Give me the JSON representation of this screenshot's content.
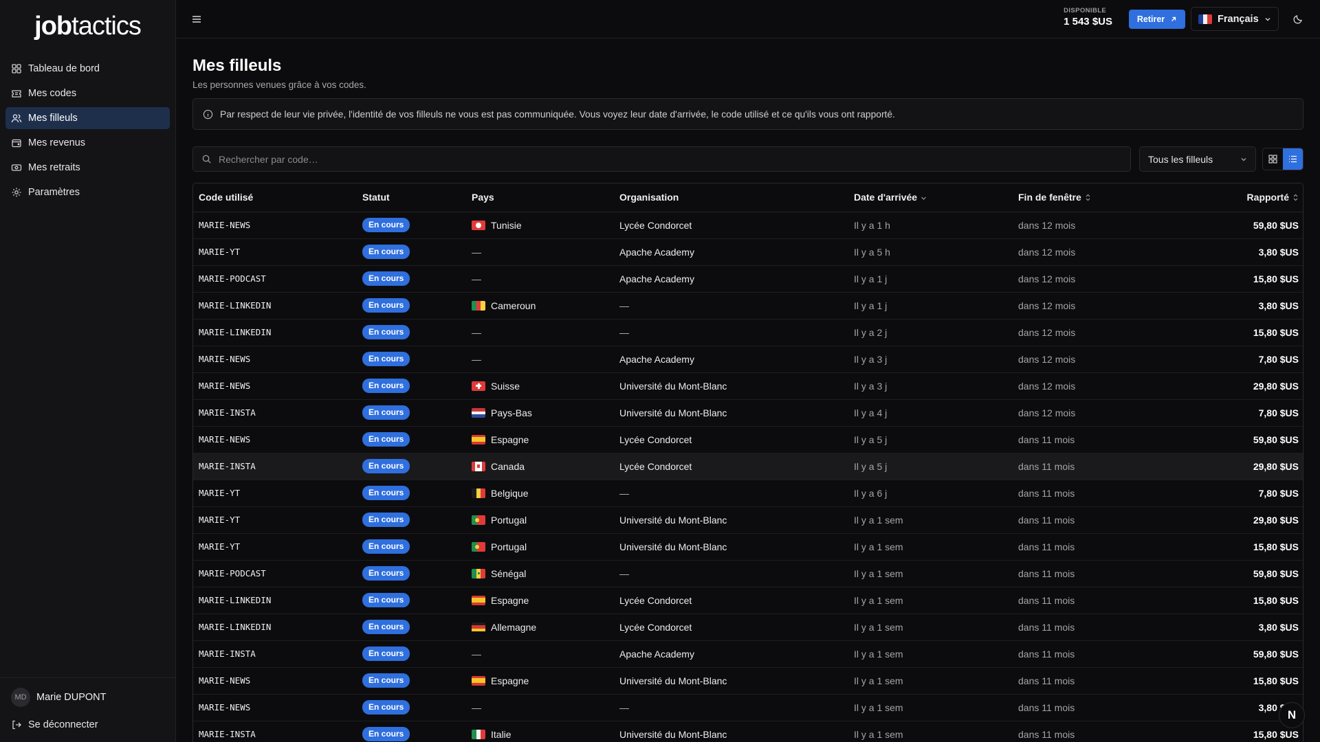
{
  "brand": {
    "logo_bold": "job",
    "logo_rest": "tactics"
  },
  "sidebar": {
    "items": [
      {
        "label": "Tableau de bord",
        "icon": "dashboard-icon"
      },
      {
        "label": "Mes codes",
        "icon": "ticket-icon"
      },
      {
        "label": "Mes filleuls",
        "icon": "users-icon",
        "active": true
      },
      {
        "label": "Mes revenus",
        "icon": "wallet-icon"
      },
      {
        "label": "Mes retraits",
        "icon": "banknote-icon"
      },
      {
        "label": "Paramètres",
        "icon": "gear-icon"
      }
    ],
    "user": {
      "initials": "MD",
      "name": "Marie DUPONT"
    },
    "logout_label": "Se déconnecter"
  },
  "topbar": {
    "balance_label": "DISPONIBLE",
    "balance_value": "1 543 $US",
    "withdraw_label": "Retirer",
    "language": "Français"
  },
  "page": {
    "title": "Mes filleuls",
    "subtitle": "Les personnes venues grâce à vos codes.",
    "notice": "Par respect de leur vie privée, l'identité de vos filleuls ne vous est pas communiquée. Vous voyez leur date d'arrivée, le code utilisé et ce qu'ils vous ont rapporté.",
    "search_placeholder": "Rechercher par code…",
    "filter_value": "Tous les filleuls"
  },
  "table": {
    "headers": {
      "code": "Code utilisé",
      "status": "Statut",
      "country": "Pays",
      "org": "Organisation",
      "arrival": "Date d'arrivée",
      "window_end": "Fin de fenêtre",
      "earned": "Rapporté"
    },
    "rows": [
      {
        "code": "MARIE-NEWS",
        "status": "En cours",
        "country": "Tunisie",
        "flag": "tn",
        "org": "Lycée Condorcet",
        "arrival": "Il y a 1 h",
        "end": "dans 12 mois",
        "amount": "59,80 $US"
      },
      {
        "code": "MARIE-YT",
        "status": "En cours",
        "country": "—",
        "flag": "",
        "org": "Apache Academy",
        "arrival": "Il y a 5 h",
        "end": "dans 12 mois",
        "amount": "3,80 $US"
      },
      {
        "code": "MARIE-PODCAST",
        "status": "En cours",
        "country": "—",
        "flag": "",
        "org": "Apache Academy",
        "arrival": "Il y a 1 j",
        "end": "dans 12 mois",
        "amount": "15,80 $US"
      },
      {
        "code": "MARIE-LINKEDIN",
        "status": "En cours",
        "country": "Cameroun",
        "flag": "cm",
        "org": "—",
        "arrival": "Il y a 1 j",
        "end": "dans 12 mois",
        "amount": "3,80 $US"
      },
      {
        "code": "MARIE-LINKEDIN",
        "status": "En cours",
        "country": "—",
        "flag": "",
        "org": "—",
        "arrival": "Il y a 2 j",
        "end": "dans 12 mois",
        "amount": "15,80 $US"
      },
      {
        "code": "MARIE-NEWS",
        "status": "En cours",
        "country": "—",
        "flag": "",
        "org": "Apache Academy",
        "arrival": "Il y a 3 j",
        "end": "dans 12 mois",
        "amount": "7,80 $US"
      },
      {
        "code": "MARIE-NEWS",
        "status": "En cours",
        "country": "Suisse",
        "flag": "ch",
        "org": "Université du Mont-Blanc",
        "arrival": "Il y a 3 j",
        "end": "dans 12 mois",
        "amount": "29,80 $US"
      },
      {
        "code": "MARIE-INSTA",
        "status": "En cours",
        "country": "Pays-Bas",
        "flag": "nl",
        "org": "Université du Mont-Blanc",
        "arrival": "Il y a 4 j",
        "end": "dans 12 mois",
        "amount": "7,80 $US"
      },
      {
        "code": "MARIE-NEWS",
        "status": "En cours",
        "country": "Espagne",
        "flag": "es",
        "org": "Lycée Condorcet",
        "arrival": "Il y a 5 j",
        "end": "dans 11 mois",
        "amount": "59,80 $US"
      },
      {
        "code": "MARIE-INSTA",
        "status": "En cours",
        "country": "Canada",
        "flag": "ca",
        "org": "Lycée Condorcet",
        "arrival": "Il y a 5 j",
        "end": "dans 11 mois",
        "amount": "29,80 $US",
        "highlight": true
      },
      {
        "code": "MARIE-YT",
        "status": "En cours",
        "country": "Belgique",
        "flag": "be",
        "org": "—",
        "arrival": "Il y a 6 j",
        "end": "dans 11 mois",
        "amount": "7,80 $US"
      },
      {
        "code": "MARIE-YT",
        "status": "En cours",
        "country": "Portugal",
        "flag": "pt",
        "org": "Université du Mont-Blanc",
        "arrival": "Il y a 1 sem",
        "end": "dans 11 mois",
        "amount": "29,80 $US"
      },
      {
        "code": "MARIE-YT",
        "status": "En cours",
        "country": "Portugal",
        "flag": "pt",
        "org": "Université du Mont-Blanc",
        "arrival": "Il y a 1 sem",
        "end": "dans 11 mois",
        "amount": "15,80 $US"
      },
      {
        "code": "MARIE-PODCAST",
        "status": "En cours",
        "country": "Sénégal",
        "flag": "sn",
        "org": "—",
        "arrival": "Il y a 1 sem",
        "end": "dans 11 mois",
        "amount": "59,80 $US"
      },
      {
        "code": "MARIE-LINKEDIN",
        "status": "En cours",
        "country": "Espagne",
        "flag": "es",
        "org": "Lycée Condorcet",
        "arrival": "Il y a 1 sem",
        "end": "dans 11 mois",
        "amount": "15,80 $US"
      },
      {
        "code": "MARIE-LINKEDIN",
        "status": "En cours",
        "country": "Allemagne",
        "flag": "de",
        "org": "Lycée Condorcet",
        "arrival": "Il y a 1 sem",
        "end": "dans 11 mois",
        "amount": "3,80 $US"
      },
      {
        "code": "MARIE-INSTA",
        "status": "En cours",
        "country": "—",
        "flag": "",
        "org": "Apache Academy",
        "arrival": "Il y a 1 sem",
        "end": "dans 11 mois",
        "amount": "59,80 $US"
      },
      {
        "code": "MARIE-NEWS",
        "status": "En cours",
        "country": "Espagne",
        "flag": "es",
        "org": "Université du Mont-Blanc",
        "arrival": "Il y a 1 sem",
        "end": "dans 11 mois",
        "amount": "15,80 $US"
      },
      {
        "code": "MARIE-NEWS",
        "status": "En cours",
        "country": "—",
        "flag": "",
        "org": "—",
        "arrival": "Il y a 1 sem",
        "end": "dans 11 mois",
        "amount": "3,80 $US"
      },
      {
        "code": "MARIE-INSTA",
        "status": "En cours",
        "country": "Italie",
        "flag": "it",
        "org": "Université du Mont-Blanc",
        "arrival": "Il y a 1 sem",
        "end": "dans 11 mois",
        "amount": "15,80 $US"
      }
    ]
  },
  "fab_label": "N",
  "colors": {
    "accent": "#2f6fde",
    "active_nav": "#1e2f4c",
    "background": "#0c0c0e"
  }
}
